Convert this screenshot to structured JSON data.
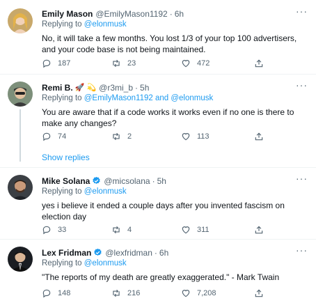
{
  "tweets": [
    {
      "name": "Emily Mason",
      "handle": "@EmilyMason1192",
      "time": "6h",
      "reply_prefix": "Replying to",
      "reply_to": "@elonmusk",
      "text": "No, it will take a few months. You lost 1/3 of your top 100 advertisers, and your code base is not being maintained.",
      "replies": "187",
      "retweets": "23",
      "likes": "472"
    },
    {
      "name": "Remi B.",
      "name_emoji": "🚀 💫",
      "handle": "@r3mi_b",
      "time": "5h",
      "reply_prefix": "Replying to",
      "reply_to": "@EmilyMason1192 and @elonmusk",
      "text": "You are aware that if a code works it works even if no one is there to make any changes?",
      "replies": "74",
      "retweets": "2",
      "likes": "113"
    },
    {
      "name": "Mike Solana",
      "handle": "@micsolana",
      "time": "5h",
      "reply_prefix": "Replying to",
      "reply_to": "@elonmusk",
      "text": "yes i believe it ended a couple days after you invented fascism on election day",
      "replies": "33",
      "retweets": "4",
      "likes": "311"
    },
    {
      "name": "Lex Fridman",
      "handle": "@lexfridman",
      "time": "6h",
      "reply_prefix": "Replying to",
      "reply_to": "@elonmusk",
      "text": "\"The reports of my death are greatly exaggerated.\" - Mark Twain",
      "replies": "148",
      "retweets": "216",
      "likes": "7,208"
    }
  ],
  "show_replies": "Show replies",
  "dot": "·",
  "more": "···",
  "colors": {
    "accent": "#1d9bf0",
    "muted": "#536471",
    "text": "#0f1419",
    "line": "#cfd9de"
  },
  "icons": [
    "reply-icon",
    "retweet-icon",
    "like-icon",
    "share-icon",
    "more-icon",
    "verified-icon"
  ]
}
